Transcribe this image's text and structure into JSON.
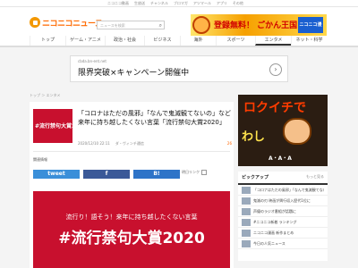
{
  "topbar": {
    "links": [
      "ニコニコ動画",
      "生放送",
      "チャンネル",
      "ブロマガ",
      "アツマール",
      "アプリ",
      "その他"
    ]
  },
  "header": {
    "logo_text": "ニコニコニュース",
    "search_placeholder": "ニュースを検索",
    "banner_text": "登録無料！ ごかん王国",
    "banner_badge": "ニコニコ漫画"
  },
  "nav": {
    "items": [
      "トップ",
      "ゲーム・アニメ",
      "政治・社会",
      "ビジネス",
      "海外",
      "スポーツ",
      "エンタメ",
      "ネット・科学"
    ],
    "active_index": 6
  },
  "ad": {
    "url": "cbda.bn-ent.net",
    "title": "限界突破×キャンペーン開催中",
    "arrow": "›"
  },
  "breadcrumb": "トップ ＞ エンタメ",
  "article": {
    "thumb_text": "#流行禁句大賞2020",
    "headline": "「コロナはただの風邪」「なんで鬼滅観てないの」など　来年に持ち越したくない言葉「流行禁句大賞2020」",
    "date": "2020/12/10 22:11",
    "source": "ダ・ヴィンチ通信",
    "comments": "26",
    "related_label": "関連情報",
    "share_twitter": "tweet",
    "share_facebook": "f",
    "share_hatena": "B!",
    "read_later": "明日リンク",
    "hero_sub": "流行り！語そう！来年に持ち越したくない言葉",
    "hero_title": "#流行禁句大賞2020"
  },
  "sidebar": {
    "ad_line1": "ロクイチで",
    "ad_line2": "わし",
    "ad_line3": "A・A・A",
    "pickup_title": "ピックアップ",
    "pickup_more": "もっと見る",
    "pickup_items": [
      "「コロナはただの風邪」「なんで鬼滅観てないの」",
      "鬼滅の刃 映画が興行収入歴代1位に",
      "声優のラジオ番組が話題に",
      "#ニコニコ新着 ランキング",
      "ニコニコ漫画 新作まとめ",
      "今日の人気ニュース"
    ]
  },
  "colors": {
    "brand": "#ff6a00",
    "hero_red": "#c8102e"
  }
}
